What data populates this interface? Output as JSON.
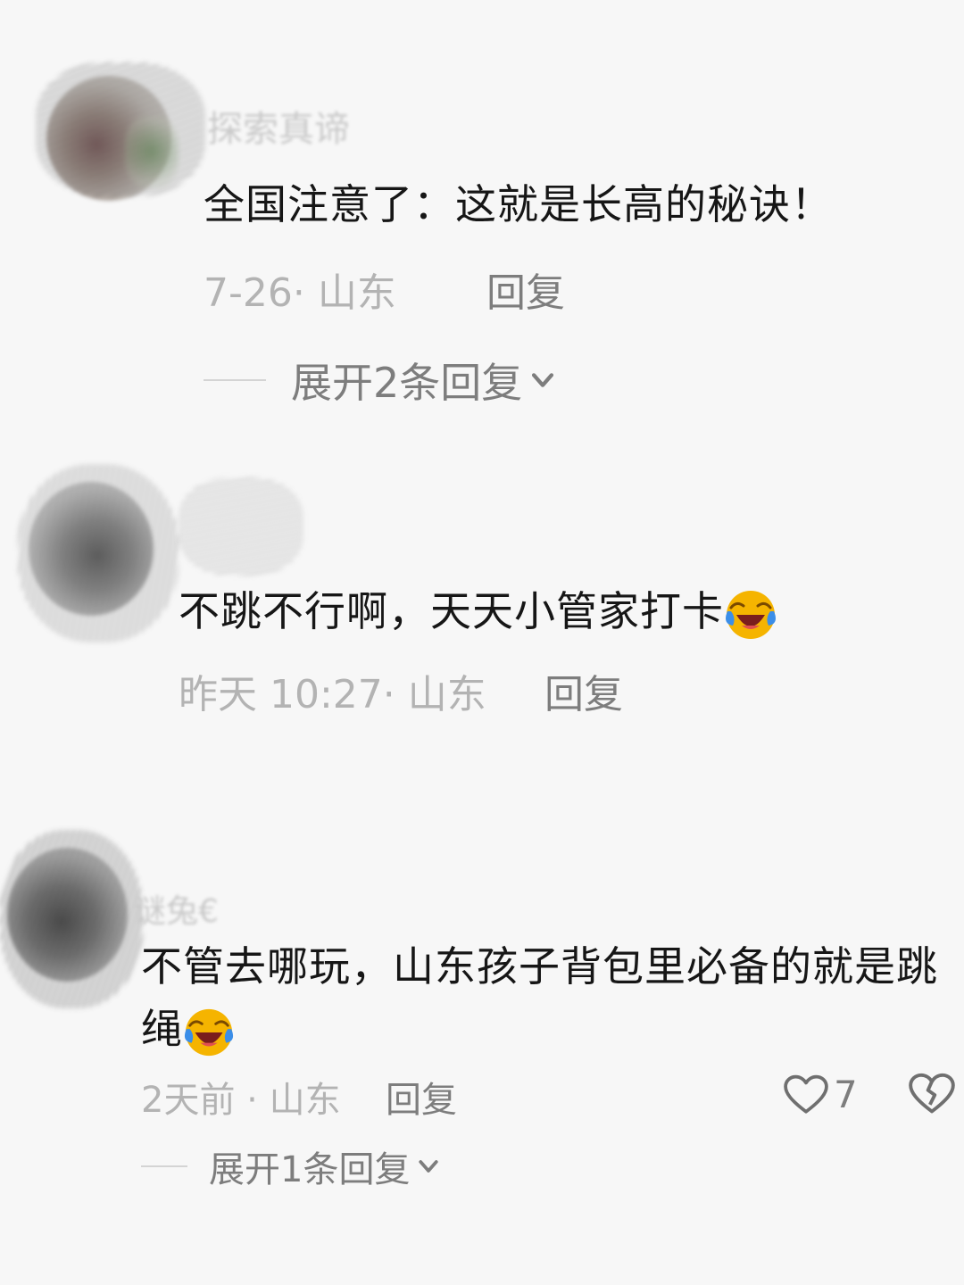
{
  "comments": [
    {
      "username": "探索真谛",
      "text": "全国注意了：这就是长高的秘诀！",
      "date": "7-26",
      "location": "山东",
      "reply_label": "回复",
      "expand_label": "展开2条回复",
      "expand_icon": "chevron-down-icon"
    },
    {
      "username": "",
      "text": "不跳不行啊，天天小管家打卡",
      "emoji": "laughing-tears-emoji",
      "date": "昨天 10:27",
      "location": "山东",
      "reply_label": "回复"
    },
    {
      "username": "谜兔€",
      "text_line1": "不管去哪玩，山东孩子背包里必备的就是跳",
      "text_line2": "绳",
      "emoji": "laughing-tears-emoji",
      "date": "2天前",
      "location": "山东",
      "reply_label": "回复",
      "like_count": "7",
      "like_icon": "heart-outline-icon",
      "dislike_icon": "broken-heart-icon",
      "expand_label": "展开1条回复",
      "expand_icon": "chevron-down-icon"
    }
  ],
  "colors": {
    "background": "#f7f7f7",
    "text": "#161616",
    "meta": "#b3b3b3",
    "reply": "#7d7d7d",
    "emoji_face": "#f5b400",
    "emoji_tears": "#3b8ee8"
  }
}
